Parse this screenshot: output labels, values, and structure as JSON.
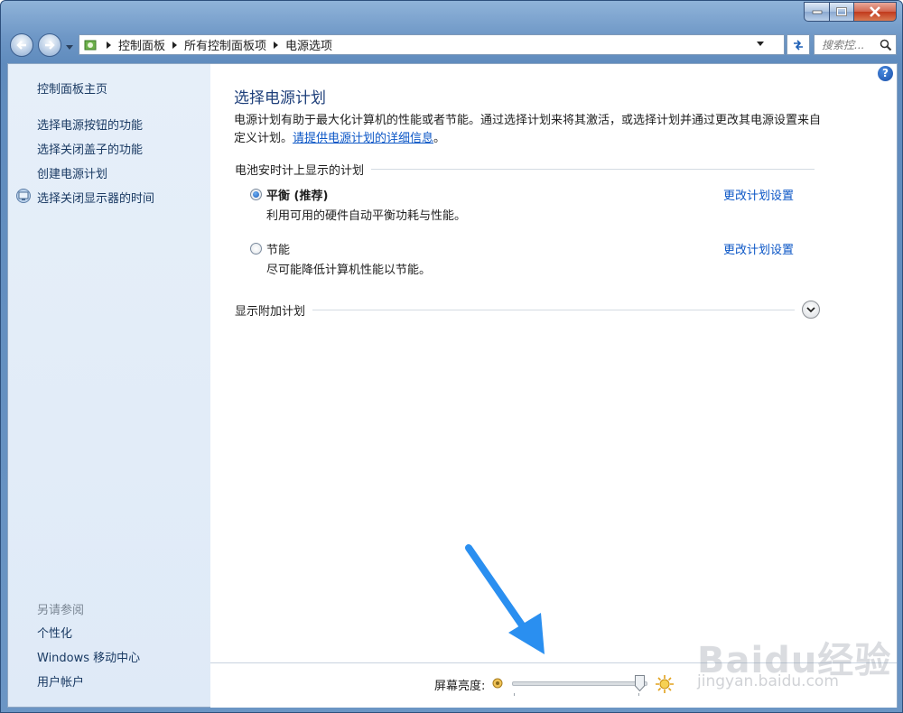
{
  "window": {
    "controls": {
      "minimize_icon": "minimize-icon",
      "maximize_icon": "maximize-icon",
      "close_icon": "close-icon"
    }
  },
  "navigation": {
    "breadcrumb": [
      "控制面板",
      "所有控制面板项",
      "电源选项"
    ],
    "search_placeholder": "搜索控...",
    "search_icon": "search-icon"
  },
  "sidebar": {
    "home": "控制面板主页",
    "items": [
      "选择电源按钮的功能",
      "选择关闭盖子的功能",
      "创建电源计划",
      "选择关闭显示器的时间"
    ],
    "see_also_title": "另请参阅",
    "see_also": [
      "个性化",
      "Windows 移动中心",
      "用户帐户"
    ]
  },
  "main": {
    "title": "选择电源计划",
    "description": "电源计划有助于最大化计算机的性能或者节能。通过选择计划来将其激活，或选择计划并通过更改其电源设置来自定义计划。",
    "description_link": "请提供电源计划的详细信息",
    "description_end": "。",
    "group_header": "电池安时计上显示的计划",
    "plans": [
      {
        "name": "平衡 (推荐)",
        "desc": "利用可用的硬件自动平衡功耗与性能。",
        "link": "更改计划设置",
        "selected": true
      },
      {
        "name": "节能",
        "desc": "尽可能降低计算机性能以节能。",
        "link": "更改计划设置",
        "selected": false
      }
    ],
    "more_plans": "显示附加计划"
  },
  "bottom": {
    "brightness_label": "屏幕亮度:",
    "brightness_level": 1.0
  },
  "watermark": {
    "logo": "Baidu经验",
    "url": "jingyan.baidu.com"
  },
  "colors": {
    "link": "#0b56c6",
    "title": "#1e3f7a",
    "sidebar_text": "#1a3a63",
    "annotation_arrow": "#2a8ff0"
  }
}
